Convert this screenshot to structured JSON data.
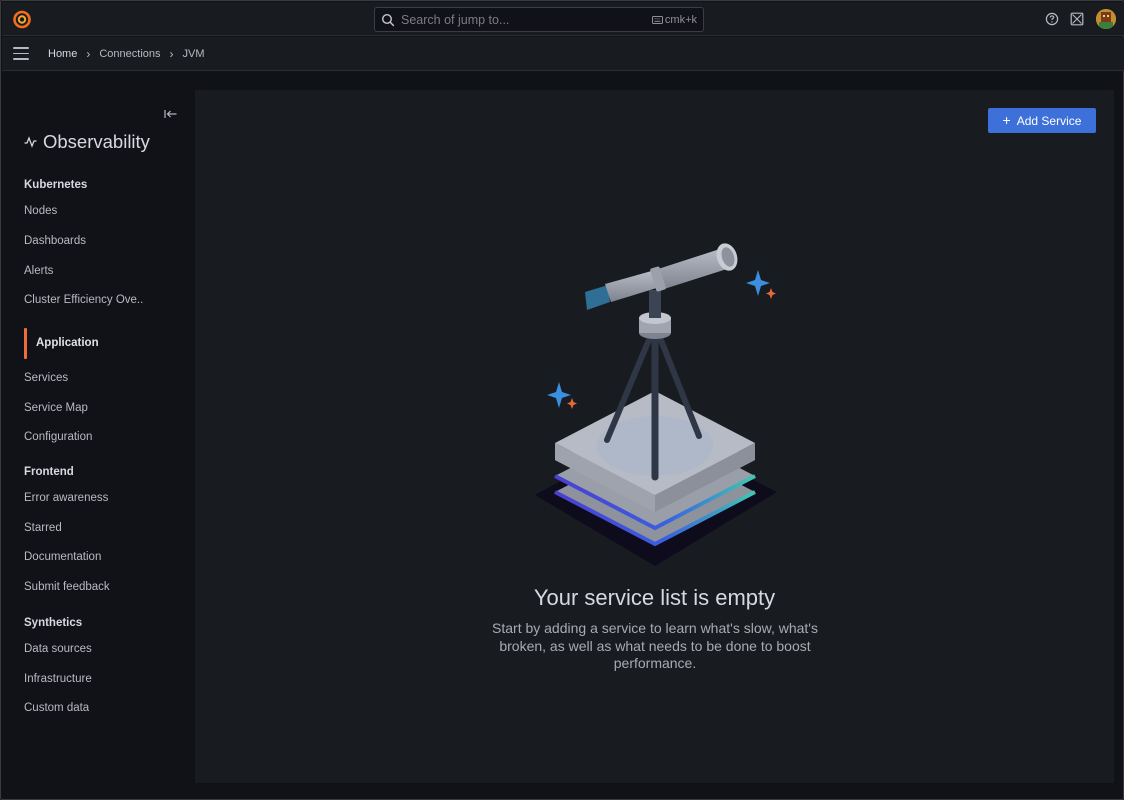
{
  "topbar": {
    "logo_icon": "grafana-logo-icon",
    "search_placeholder": "Search of jump to...",
    "search_shortcut": "cmk+k",
    "help_icon": "help-circle-icon",
    "news_icon": "news-icon",
    "avatar_icon": "user-avatar-icon"
  },
  "breadcrumb": {
    "items": [
      "Home",
      "Connections",
      "JVM"
    ]
  },
  "sidebar": {
    "title": "Observability",
    "sections": [
      {
        "label": "Kubernetes",
        "items": [
          "Nodes",
          "Dashboards",
          "Alerts",
          "Cluster Efficiency Ove.."
        ]
      },
      {
        "label": "Application",
        "items": [
          "Services",
          "Service Map",
          "Configuration"
        ]
      },
      {
        "label": "Frontend",
        "items": [
          "Error awareness",
          "Starred",
          "Documentation",
          "Submit feedback"
        ]
      },
      {
        "label": "Synthetics",
        "items": [
          "Data sources",
          "Infrastructure",
          "Custom data"
        ]
      }
    ]
  },
  "main": {
    "add_service_label": "Add Service",
    "empty_title": "Your service list is empty",
    "empty_description": "Start by adding a service to learn what's slow, what's broken, as well as what needs to be done to boost performance."
  },
  "colors": {
    "accent": "#3d71d9",
    "active_indicator": "#f06c3a",
    "background": "#111217",
    "panel": "#181b1f"
  }
}
